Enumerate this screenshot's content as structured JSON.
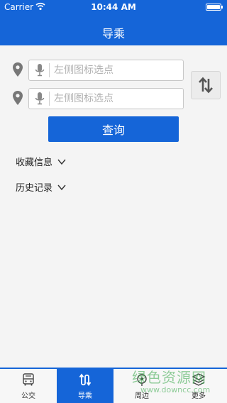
{
  "status_bar": {
    "carrier": "Carrier",
    "time": "10:44 AM"
  },
  "header": {
    "title": "导乘"
  },
  "route": {
    "start": {
      "value": "",
      "placeholder": "左侧图标选点"
    },
    "end": {
      "value": "",
      "placeholder": "左侧图标选点"
    }
  },
  "query_button": "查询",
  "sections": {
    "favorites": "收藏信息",
    "history": "历史记录"
  },
  "tabs": [
    {
      "label": "公交",
      "icon": "bus-icon"
    },
    {
      "label": "导乘",
      "icon": "route-icon"
    },
    {
      "label": "周边",
      "icon": "nearby-icon"
    },
    {
      "label": "更多",
      "icon": "more-icon"
    }
  ],
  "watermark": {
    "text": "绿色资源网",
    "url": "www.downcc.com"
  },
  "colors": {
    "primary": "#1565d8",
    "background": "#f4f4f4",
    "watermark": "#37a84a"
  }
}
